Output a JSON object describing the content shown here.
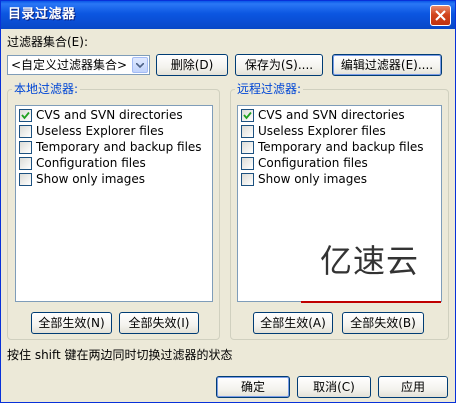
{
  "window": {
    "title": "目录过滤器"
  },
  "filter_set": {
    "label": "过滤器集合(E):",
    "selected": "<自定义过滤器集合>",
    "delete_label": "删除(D)",
    "save_as_label": "保存为(S)....",
    "edit_label": "编辑过滤器(E)...."
  },
  "local": {
    "title": "本地过滤器:",
    "items": [
      {
        "label": "CVS and SVN directories",
        "checked": true
      },
      {
        "label": "Useless Explorer files",
        "checked": false
      },
      {
        "label": "Temporary and backup files",
        "checked": false
      },
      {
        "label": "Configuration files",
        "checked": false
      },
      {
        "label": "Show only images",
        "checked": false
      }
    ],
    "enable_all_label": "全部生效(N)",
    "disable_all_label": "全部失效(I)"
  },
  "remote": {
    "title": "远程过滤器:",
    "items": [
      {
        "label": "CVS and SVN directories",
        "checked": true
      },
      {
        "label": "Useless Explorer files",
        "checked": false
      },
      {
        "label": "Temporary and backup files",
        "checked": false
      },
      {
        "label": "Configuration files",
        "checked": false
      },
      {
        "label": "Show only images",
        "checked": false
      }
    ],
    "enable_all_label": "全部生效(A)",
    "disable_all_label": "全部失效(B)"
  },
  "hint": "按住 shift 键在两边同时切换过滤器的状态",
  "footer": {
    "ok_label": "确定",
    "cancel_label": "取消(C)",
    "apply_label": "应用"
  },
  "watermark": {
    "text": "亿速云"
  },
  "colors": {
    "titlebar": "#0a4fd6",
    "dialog_bg": "#ece9d8",
    "group_title": "#0046d5",
    "close_button": "#d2451c"
  }
}
